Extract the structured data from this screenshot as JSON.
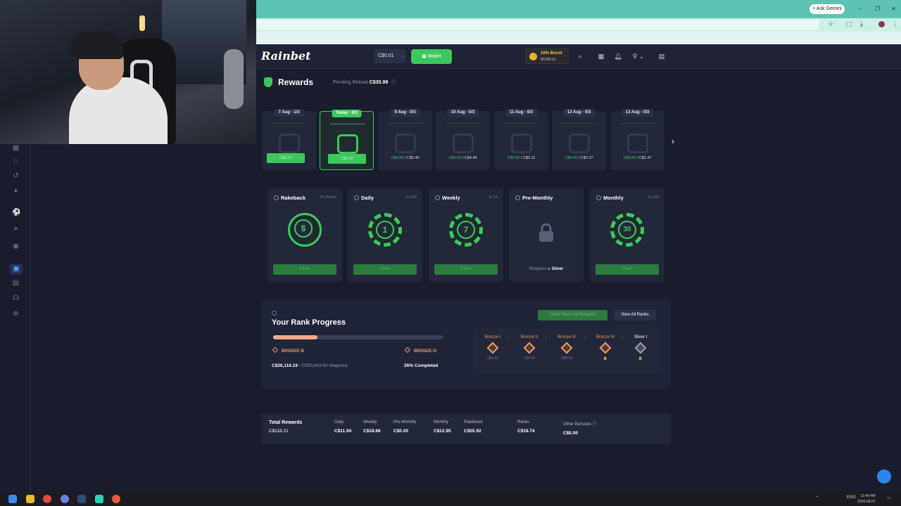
{
  "browser": {
    "ask_gemini": "+ Ask Gemini",
    "window_controls": [
      "–",
      "❐",
      "✕"
    ]
  },
  "header": {
    "logo": "Rainbet",
    "balance": "C$0.01",
    "wallet": "Wallet",
    "boost_title": "10% Boost",
    "boost_timer": "00:56:12"
  },
  "rewards": {
    "title": "Rewards",
    "pending_label": "Pending Reload",
    "pending_value": "C$30.99"
  },
  "days": [
    {
      "label": "7 Aug - 1/3",
      "amount": "C$0.27",
      "state": "claimable"
    },
    {
      "label": "Today - 0/3",
      "amount": "C$2.52",
      "state": "today"
    },
    {
      "label": "9 Aug - 0/3",
      "amount_a": "C$0.00",
      "amount_b": "C$5.40",
      "state": "future"
    },
    {
      "label": "10 Aug - 0/3",
      "amount_a": "C$0.00",
      "amount_b": "C$4.44",
      "state": "future"
    },
    {
      "label": "11 Aug - 0/3",
      "amount_a": "C$0.00",
      "amount_b": "C$3.11",
      "state": "future"
    },
    {
      "label": "12 Aug - 0/3",
      "amount_a": "C$0.00",
      "amount_b": "C$2.37",
      "state": "future"
    },
    {
      "label": "13 Aug - 0/3",
      "amount_a": "C$0.00",
      "amount_b": "C$1.47",
      "state": "future"
    }
  ],
  "reward_cards": [
    {
      "name": "Rakeback",
      "sub": "No Funds",
      "chip": "$",
      "button": "Claim"
    },
    {
      "name": "Daily",
      "sub": "In 23h",
      "chip": "1",
      "button": "Claim"
    },
    {
      "name": "Weekly",
      "sub": "In 1d",
      "chip": "7",
      "button": "Claim"
    },
    {
      "name": "Pre-Monthly",
      "sub": "",
      "requires": "Requires",
      "requires_rank": "Silver"
    },
    {
      "name": "Monthly",
      "sub": "In 23d",
      "chip": "30",
      "button": "Claim"
    }
  ],
  "rank": {
    "title": "Your Rank Progress",
    "claim_button": "Claim Rank Up Rewards",
    "view_button": "View All Ranks",
    "progress": 0.26,
    "from": "BRONZE III",
    "to": "BRONZE IV",
    "wagered_value": "C$36,116.19",
    "wagered_target": "/ C$50,643.60 Wagered",
    "completed": "26% Completed",
    "tiers": [
      {
        "name": "Bronze I",
        "value": "C$4.16"
      },
      {
        "name": "Bronze II",
        "value": "C$6.24"
      },
      {
        "name": "Bronze III",
        "value": "C$8.34"
      },
      {
        "name": "Bronze IV",
        "value": "🔒"
      },
      {
        "name": "Silver I",
        "value": "🔒"
      }
    ]
  },
  "totals": {
    "title": "Total Rewards",
    "value": "C$118.21",
    "cols": [
      {
        "label": "Daily",
        "value": "C$11.94"
      },
      {
        "label": "Weekly",
        "value": "C$18.66"
      },
      {
        "label": "Pre-Monthly",
        "value": "C$0.00"
      },
      {
        "label": "Monthly",
        "value": "C$12.95"
      },
      {
        "label": "Rakeback",
        "value": "C$55.92"
      },
      {
        "label": "Ranks",
        "value": "C$18.74"
      },
      {
        "label": "Other Bonuses",
        "value": "C$0.00"
      }
    ]
  },
  "taskbar": {
    "lang": "ENG",
    "time": "11:44 PM",
    "date": "2026-08-07"
  },
  "colors": {
    "accent": "#3cc85c",
    "bronze": "#e59b66",
    "bg": "#1a1d2e"
  }
}
